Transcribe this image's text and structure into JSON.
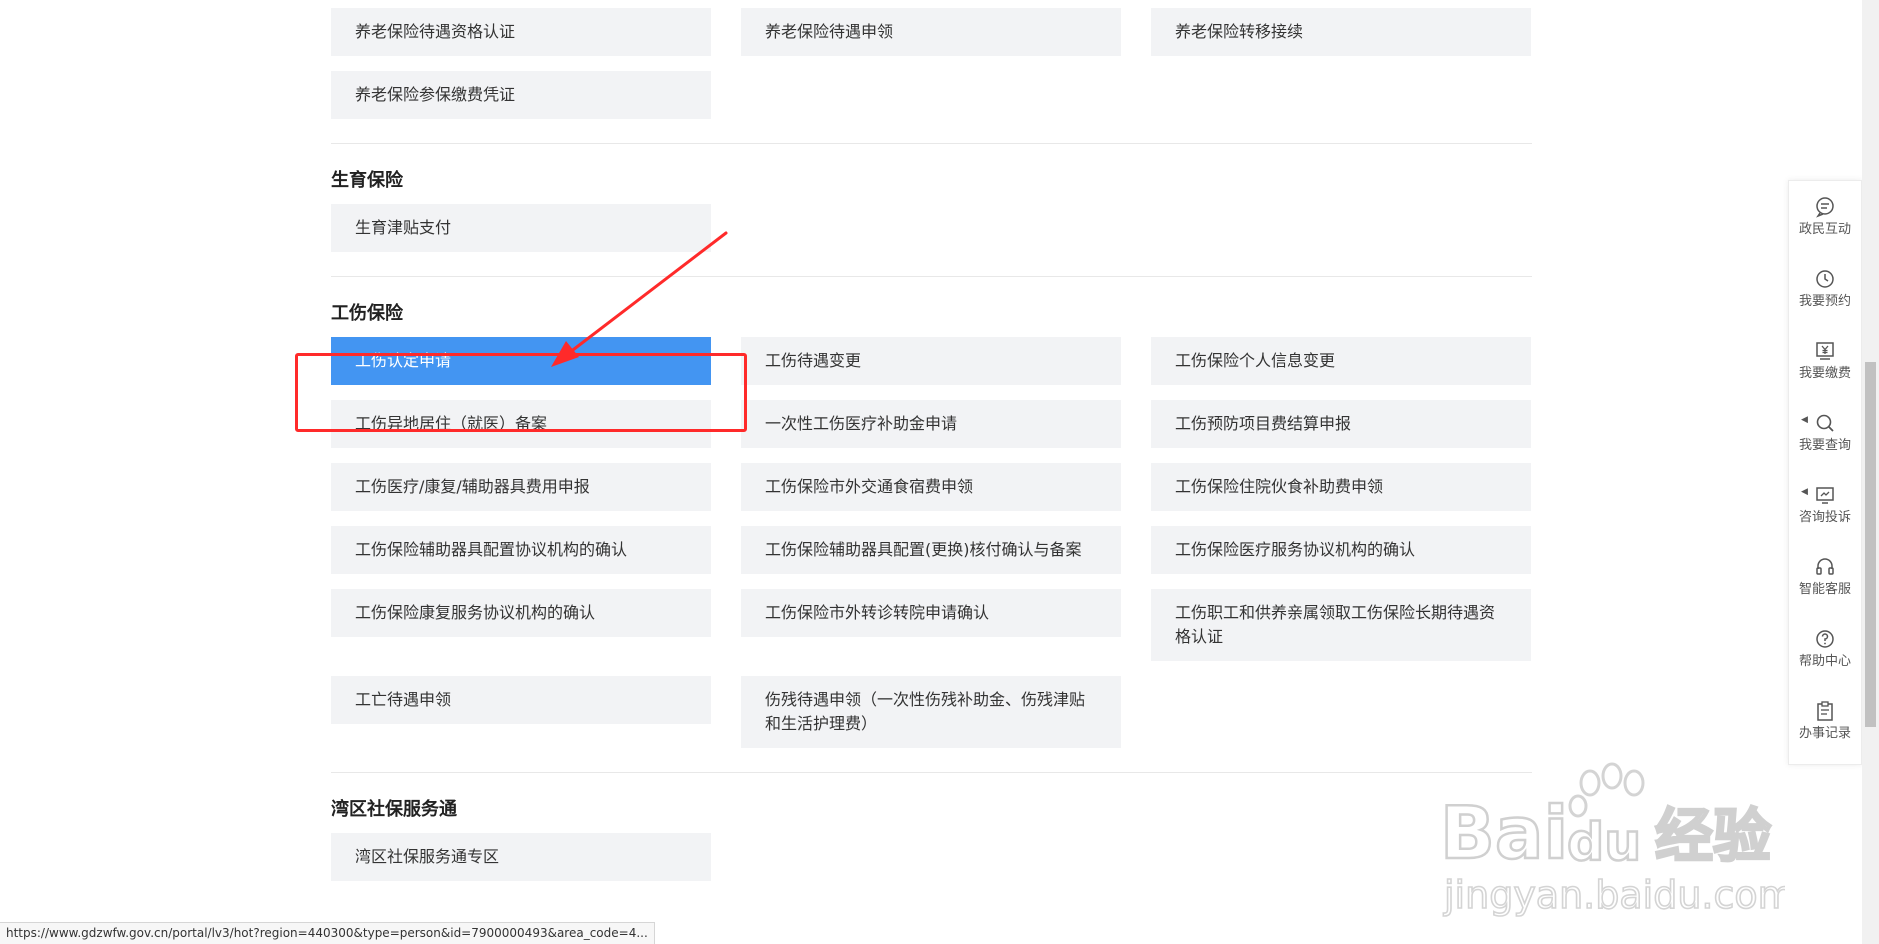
{
  "sections": {
    "pension": {
      "items": [
        "养老保险待遇资格认证",
        "养老保险待遇申领",
        "养老保险转移接续",
        "养老保险参保缴费凭证"
      ]
    },
    "maternity": {
      "title": "生育保险",
      "items": [
        "生育津贴支付"
      ]
    },
    "injury": {
      "title": "工伤保险",
      "items": [
        "工伤认定申请",
        "工伤待遇变更",
        "工伤保险个人信息变更",
        "工伤异地居住（就医）备案",
        "一次性工伤医疗补助金申请",
        "工伤预防项目费结算申报",
        "工伤医疗/康复/辅助器具费用申报",
        "工伤保险市外交通食宿费申领",
        "工伤保险住院伙食补助费申领",
        "工伤保险辅助器具配置协议机构的确认",
        "工伤保险辅助器具配置(更换)核付确认与备案",
        "工伤保险医疗服务协议机构的确认",
        "工伤保险康复服务协议机构的确认",
        "工伤保险市外转诊转院申请确认",
        "工伤职工和供养亲属领取工伤保险长期待遇资格认证",
        "工亡待遇申领",
        "伤残待遇申领（一次性伤残补助金、伤残津贴和生活护理费）"
      ],
      "active_index": 0
    },
    "bay": {
      "title": "湾区社保服务通",
      "items": [
        "湾区社保服务通专区"
      ]
    }
  },
  "sidebar": {
    "items": [
      {
        "label": "政民互动",
        "icon": "chat-icon"
      },
      {
        "label": "我要预约",
        "icon": "clock-icon"
      },
      {
        "label": "我要缴费",
        "icon": "yuan-icon"
      },
      {
        "label": "我要查询",
        "icon": "search-icon"
      },
      {
        "label": "咨询投诉",
        "icon": "monitor-icon"
      },
      {
        "label": "智能客服",
        "icon": "headset-icon"
      },
      {
        "label": "帮助中心",
        "icon": "help-icon"
      },
      {
        "label": "办事记录",
        "icon": "clipboard-icon"
      }
    ]
  },
  "status_url": "https://www.gdzwfw.gov.cn/portal/lv3/hot?region=440300&type=person&id=7900000493&area_code=4...",
  "watermark": {
    "brand": "Bai",
    "brand_mid": "du",
    "brand_cn": "经验",
    "site": "jingyan.baidu.com"
  },
  "colors": {
    "active": "#4395f2",
    "item_bg": "#f2f3f5",
    "annotation": "#ff2a2a"
  }
}
